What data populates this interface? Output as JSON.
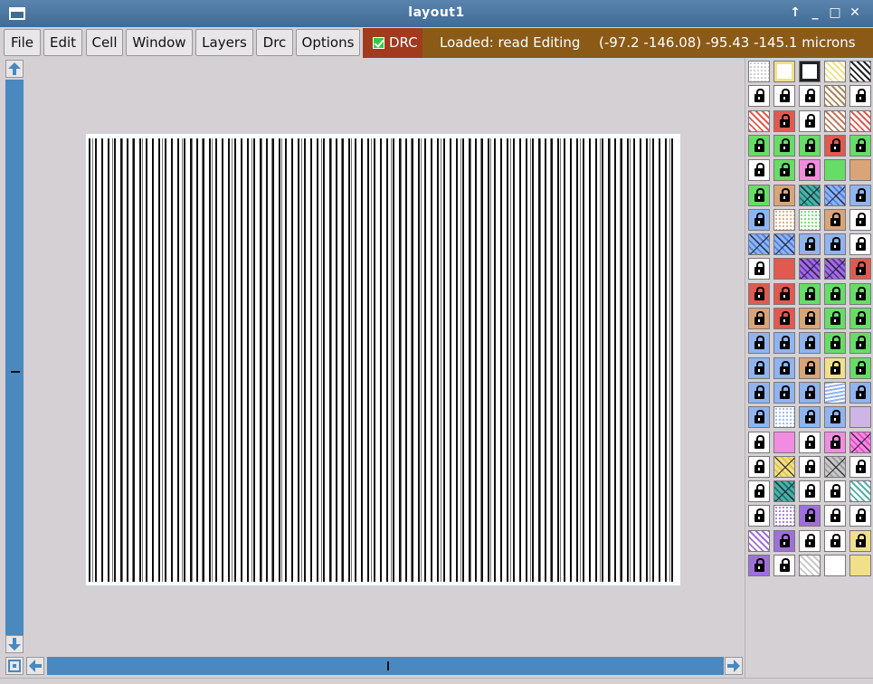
{
  "window": {
    "title": "layout1",
    "controls": [
      "↑",
      "_",
      "□",
      "✕"
    ]
  },
  "menu": {
    "items": [
      "File",
      "Edit",
      "Cell",
      "Window",
      "Layers",
      "Drc",
      "Options"
    ]
  },
  "drc": {
    "label": "DRC",
    "checked": true
  },
  "status": {
    "message": "Loaded: read Editing",
    "coords": "(-97.2 -146.08) -95.43 -145.1 microns"
  },
  "layer_palette": {
    "rows": [
      [
        "dots-grey",
        "outline-yellow",
        "outline-black",
        "hatch-yellow",
        "hatch-black"
      ],
      [
        "lock-white",
        "lock-white",
        "lock-white",
        "hatch-brown",
        "lock-white"
      ],
      [
        "hatch-red",
        "lock-red",
        "lock-white",
        "hatch-brownred",
        "hatch-red"
      ],
      [
        "lock-green",
        "lock-green",
        "lock-green",
        "lock-red",
        "lock-green"
      ],
      [
        "lock-white",
        "lock-green",
        "lock-pink",
        "solid-green",
        "solid-tan"
      ],
      [
        "lock-green",
        "lock-tan",
        "cross-teal",
        "cross-blue",
        "lock-blue"
      ],
      [
        "lock-blue",
        "dots-tan",
        "dots-green",
        "lock-tan",
        "lock-white"
      ],
      [
        "cross-blue",
        "cross-blue",
        "lock-blue",
        "lock-blue",
        "lock-white"
      ],
      [
        "lock-white",
        "solid-red",
        "cross-purple",
        "cross-purple",
        "lock-red"
      ],
      [
        "lock-red",
        "lock-red",
        "lock-green",
        "lock-green",
        "lock-green"
      ],
      [
        "lock-tan",
        "lock-red",
        "lock-tan",
        "lock-green",
        "lock-green"
      ],
      [
        "lock-blue",
        "lock-blue",
        "lock-blue",
        "lock-green",
        "lock-green"
      ],
      [
        "lock-blue",
        "lock-blue",
        "lock-tan",
        "lock-yellow",
        "lock-green"
      ],
      [
        "lock-blue",
        "lock-blue",
        "lock-blue",
        "wave-blue",
        "lock-blue"
      ],
      [
        "lock-blue",
        "dots-blue",
        "lock-blue",
        "lock-blue",
        "solid-lilac"
      ],
      [
        "lock-white",
        "solid-pink",
        "lock-white",
        "lock-pink",
        "cross-pink"
      ],
      [
        "lock-white",
        "cross-yellow",
        "lock-white",
        "cross-grey",
        "lock-white"
      ],
      [
        "lock-white",
        "cross-teal",
        "lock-white",
        "lock-white",
        "hatch-teal"
      ],
      [
        "lock-white",
        "dots-purple",
        "lock-purple",
        "lock-white",
        "lock-white"
      ],
      [
        "hatch-purple",
        "lock-purple",
        "lock-white",
        "lock-white",
        "lock-yellow"
      ],
      [
        "lock-purple",
        "lock-white",
        "hatch-grey",
        "dots-white",
        "solid-yellow"
      ]
    ]
  },
  "colors": {
    "titlebar": "#3f6b95",
    "drc_bg": "#a23a1e",
    "status_bg": "#8b5a17",
    "scroll_track": "#4a88bf",
    "canvas_bg": "#d4d0d4"
  }
}
